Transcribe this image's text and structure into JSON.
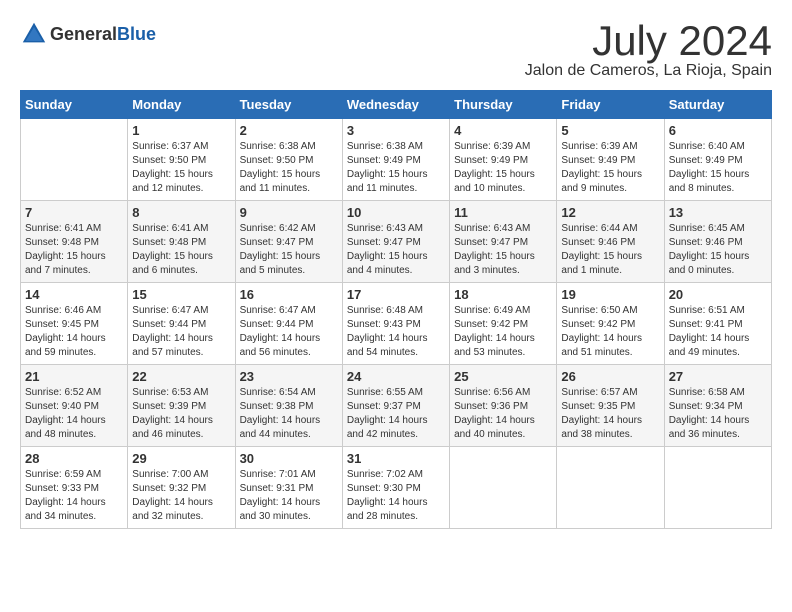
{
  "header": {
    "logo_general": "General",
    "logo_blue": "Blue",
    "month": "July 2024",
    "location": "Jalon de Cameros, La Rioja, Spain"
  },
  "days_of_week": [
    "Sunday",
    "Monday",
    "Tuesday",
    "Wednesday",
    "Thursday",
    "Friday",
    "Saturday"
  ],
  "weeks": [
    [
      {
        "day": "",
        "sunrise": "",
        "sunset": "",
        "daylight": ""
      },
      {
        "day": "1",
        "sunrise": "Sunrise: 6:37 AM",
        "sunset": "Sunset: 9:50 PM",
        "daylight": "Daylight: 15 hours and 12 minutes."
      },
      {
        "day": "2",
        "sunrise": "Sunrise: 6:38 AM",
        "sunset": "Sunset: 9:50 PM",
        "daylight": "Daylight: 15 hours and 11 minutes."
      },
      {
        "day": "3",
        "sunrise": "Sunrise: 6:38 AM",
        "sunset": "Sunset: 9:49 PM",
        "daylight": "Daylight: 15 hours and 11 minutes."
      },
      {
        "day": "4",
        "sunrise": "Sunrise: 6:39 AM",
        "sunset": "Sunset: 9:49 PM",
        "daylight": "Daylight: 15 hours and 10 minutes."
      },
      {
        "day": "5",
        "sunrise": "Sunrise: 6:39 AM",
        "sunset": "Sunset: 9:49 PM",
        "daylight": "Daylight: 15 hours and 9 minutes."
      },
      {
        "day": "6",
        "sunrise": "Sunrise: 6:40 AM",
        "sunset": "Sunset: 9:49 PM",
        "daylight": "Daylight: 15 hours and 8 minutes."
      }
    ],
    [
      {
        "day": "7",
        "sunrise": "Sunrise: 6:41 AM",
        "sunset": "Sunset: 9:48 PM",
        "daylight": "Daylight: 15 hours and 7 minutes."
      },
      {
        "day": "8",
        "sunrise": "Sunrise: 6:41 AM",
        "sunset": "Sunset: 9:48 PM",
        "daylight": "Daylight: 15 hours and 6 minutes."
      },
      {
        "day": "9",
        "sunrise": "Sunrise: 6:42 AM",
        "sunset": "Sunset: 9:47 PM",
        "daylight": "Daylight: 15 hours and 5 minutes."
      },
      {
        "day": "10",
        "sunrise": "Sunrise: 6:43 AM",
        "sunset": "Sunset: 9:47 PM",
        "daylight": "Daylight: 15 hours and 4 minutes."
      },
      {
        "day": "11",
        "sunrise": "Sunrise: 6:43 AM",
        "sunset": "Sunset: 9:47 PM",
        "daylight": "Daylight: 15 hours and 3 minutes."
      },
      {
        "day": "12",
        "sunrise": "Sunrise: 6:44 AM",
        "sunset": "Sunset: 9:46 PM",
        "daylight": "Daylight: 15 hours and 1 minute."
      },
      {
        "day": "13",
        "sunrise": "Sunrise: 6:45 AM",
        "sunset": "Sunset: 9:46 PM",
        "daylight": "Daylight: 15 hours and 0 minutes."
      }
    ],
    [
      {
        "day": "14",
        "sunrise": "Sunrise: 6:46 AM",
        "sunset": "Sunset: 9:45 PM",
        "daylight": "Daylight: 14 hours and 59 minutes."
      },
      {
        "day": "15",
        "sunrise": "Sunrise: 6:47 AM",
        "sunset": "Sunset: 9:44 PM",
        "daylight": "Daylight: 14 hours and 57 minutes."
      },
      {
        "day": "16",
        "sunrise": "Sunrise: 6:47 AM",
        "sunset": "Sunset: 9:44 PM",
        "daylight": "Daylight: 14 hours and 56 minutes."
      },
      {
        "day": "17",
        "sunrise": "Sunrise: 6:48 AM",
        "sunset": "Sunset: 9:43 PM",
        "daylight": "Daylight: 14 hours and 54 minutes."
      },
      {
        "day": "18",
        "sunrise": "Sunrise: 6:49 AM",
        "sunset": "Sunset: 9:42 PM",
        "daylight": "Daylight: 14 hours and 53 minutes."
      },
      {
        "day": "19",
        "sunrise": "Sunrise: 6:50 AM",
        "sunset": "Sunset: 9:42 PM",
        "daylight": "Daylight: 14 hours and 51 minutes."
      },
      {
        "day": "20",
        "sunrise": "Sunrise: 6:51 AM",
        "sunset": "Sunset: 9:41 PM",
        "daylight": "Daylight: 14 hours and 49 minutes."
      }
    ],
    [
      {
        "day": "21",
        "sunrise": "Sunrise: 6:52 AM",
        "sunset": "Sunset: 9:40 PM",
        "daylight": "Daylight: 14 hours and 48 minutes."
      },
      {
        "day": "22",
        "sunrise": "Sunrise: 6:53 AM",
        "sunset": "Sunset: 9:39 PM",
        "daylight": "Daylight: 14 hours and 46 minutes."
      },
      {
        "day": "23",
        "sunrise": "Sunrise: 6:54 AM",
        "sunset": "Sunset: 9:38 PM",
        "daylight": "Daylight: 14 hours and 44 minutes."
      },
      {
        "day": "24",
        "sunrise": "Sunrise: 6:55 AM",
        "sunset": "Sunset: 9:37 PM",
        "daylight": "Daylight: 14 hours and 42 minutes."
      },
      {
        "day": "25",
        "sunrise": "Sunrise: 6:56 AM",
        "sunset": "Sunset: 9:36 PM",
        "daylight": "Daylight: 14 hours and 40 minutes."
      },
      {
        "day": "26",
        "sunrise": "Sunrise: 6:57 AM",
        "sunset": "Sunset: 9:35 PM",
        "daylight": "Daylight: 14 hours and 38 minutes."
      },
      {
        "day": "27",
        "sunrise": "Sunrise: 6:58 AM",
        "sunset": "Sunset: 9:34 PM",
        "daylight": "Daylight: 14 hours and 36 minutes."
      }
    ],
    [
      {
        "day": "28",
        "sunrise": "Sunrise: 6:59 AM",
        "sunset": "Sunset: 9:33 PM",
        "daylight": "Daylight: 14 hours and 34 minutes."
      },
      {
        "day": "29",
        "sunrise": "Sunrise: 7:00 AM",
        "sunset": "Sunset: 9:32 PM",
        "daylight": "Daylight: 14 hours and 32 minutes."
      },
      {
        "day": "30",
        "sunrise": "Sunrise: 7:01 AM",
        "sunset": "Sunset: 9:31 PM",
        "daylight": "Daylight: 14 hours and 30 minutes."
      },
      {
        "day": "31",
        "sunrise": "Sunrise: 7:02 AM",
        "sunset": "Sunset: 9:30 PM",
        "daylight": "Daylight: 14 hours and 28 minutes."
      },
      {
        "day": "",
        "sunrise": "",
        "sunset": "",
        "daylight": ""
      },
      {
        "day": "",
        "sunrise": "",
        "sunset": "",
        "daylight": ""
      },
      {
        "day": "",
        "sunrise": "",
        "sunset": "",
        "daylight": ""
      }
    ]
  ]
}
